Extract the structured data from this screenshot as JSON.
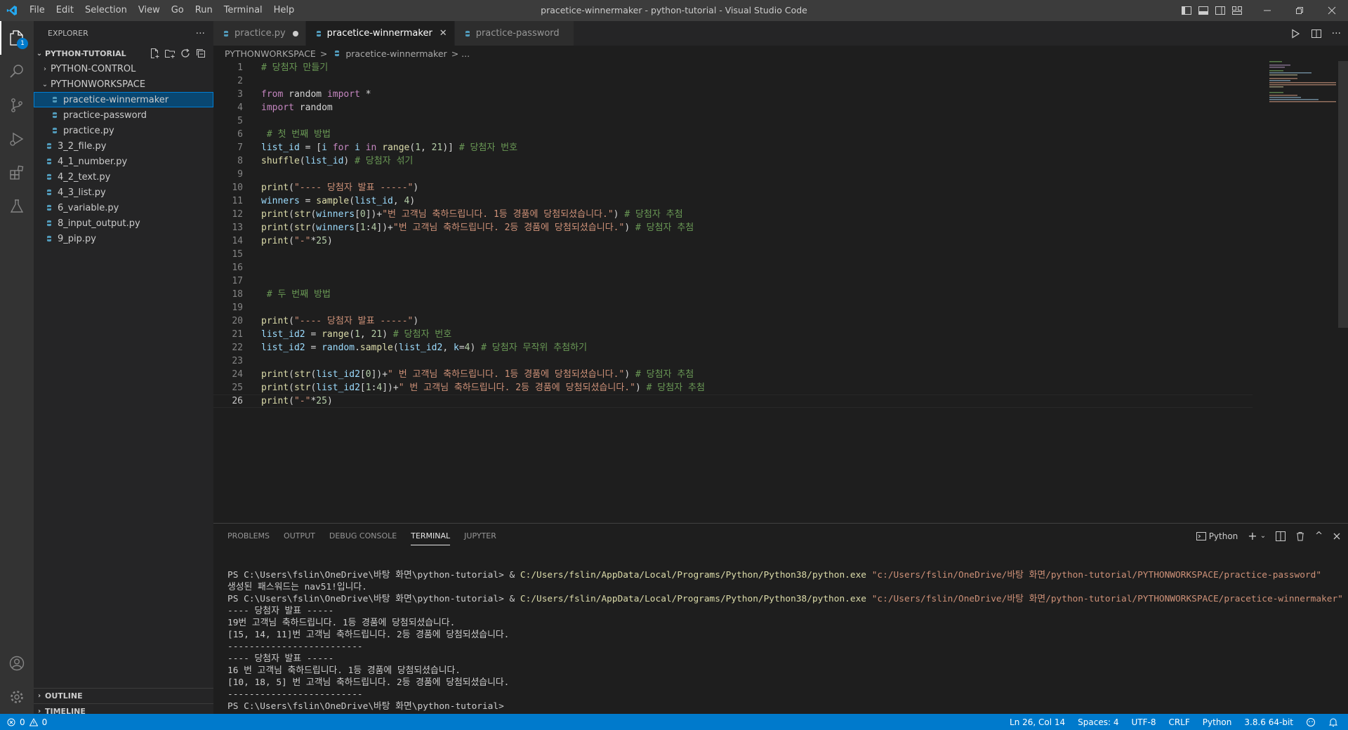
{
  "window": {
    "title": "pracetice-winnermaker - python-tutorial - Visual Studio Code",
    "menu": [
      "File",
      "Edit",
      "Selection",
      "View",
      "Go",
      "Run",
      "Terminal",
      "Help"
    ]
  },
  "activity": {
    "explorer_badge": "1"
  },
  "sidebar": {
    "title": "EXPLORER",
    "more": "···",
    "root": "PYTHON-TUTORIAL",
    "items": [
      {
        "label": "PYTHON-CONTROL",
        "kind": "folder",
        "expanded": false,
        "indent": 1
      },
      {
        "label": "PYTHONWORKSPACE",
        "kind": "folder",
        "expanded": true,
        "indent": 1
      },
      {
        "label": "pracetice-winnermaker",
        "kind": "file",
        "indent": 2,
        "selected": true
      },
      {
        "label": "practice-password",
        "kind": "file",
        "indent": 2
      },
      {
        "label": "practice.py",
        "kind": "file",
        "indent": 2
      },
      {
        "label": "3_2_file.py",
        "kind": "file",
        "indent": 1
      },
      {
        "label": "4_1_number.py",
        "kind": "file",
        "indent": 1
      },
      {
        "label": "4_2_text.py",
        "kind": "file",
        "indent": 1
      },
      {
        "label": "4_3_list.py",
        "kind": "file",
        "indent": 1
      },
      {
        "label": "6_variable.py",
        "kind": "file",
        "indent": 1
      },
      {
        "label": "8_input_output.py",
        "kind": "file",
        "indent": 1
      },
      {
        "label": "9_pip.py",
        "kind": "file",
        "indent": 1
      }
    ],
    "outline": "OUTLINE",
    "timeline": "TIMELINE"
  },
  "tabs": [
    {
      "label": "practice.py",
      "modified": true,
      "active": false
    },
    {
      "label": "pracetice-winnermaker",
      "modified": false,
      "active": true,
      "close": "✕"
    },
    {
      "label": "practice-password",
      "modified": false,
      "active": false
    }
  ],
  "breadcrumb": {
    "folder": "PYTHONWORKSPACE",
    "sep": ">",
    "file": "pracetice-winnermaker",
    "more": "> ..."
  },
  "code": {
    "current_line": 26,
    "lines": [
      [
        {
          "t": "# 당첨자 만들기",
          "c": "cm"
        }
      ],
      [],
      [
        {
          "t": "from",
          "c": "kw"
        },
        {
          "t": " random ",
          "c": "pl"
        },
        {
          "t": "import",
          "c": "kw"
        },
        {
          "t": " *",
          "c": "pl"
        }
      ],
      [
        {
          "t": "import",
          "c": "kw"
        },
        {
          "t": " random",
          "c": "pl"
        }
      ],
      [],
      [
        {
          "t": " # 첫 번째 방법",
          "c": "cm"
        }
      ],
      [
        {
          "t": "list_id",
          "c": "var"
        },
        {
          "t": " = [",
          "c": "pl"
        },
        {
          "t": "i",
          "c": "var"
        },
        {
          "t": " for ",
          "c": "kw"
        },
        {
          "t": "i",
          "c": "var"
        },
        {
          "t": " in ",
          "c": "kw"
        },
        {
          "t": "range",
          "c": "fn"
        },
        {
          "t": "(",
          "c": "pl"
        },
        {
          "t": "1",
          "c": "num"
        },
        {
          "t": ", ",
          "c": "pl"
        },
        {
          "t": "21",
          "c": "num"
        },
        {
          "t": ")] ",
          "c": "pl"
        },
        {
          "t": "# 당첨자 번호",
          "c": "cm"
        }
      ],
      [
        {
          "t": "shuffle",
          "c": "fn"
        },
        {
          "t": "(",
          "c": "pl"
        },
        {
          "t": "list_id",
          "c": "var"
        },
        {
          "t": ") ",
          "c": "pl"
        },
        {
          "t": "# 당첨자 섞기",
          "c": "cm"
        }
      ],
      [],
      [
        {
          "t": "print",
          "c": "fn"
        },
        {
          "t": "(",
          "c": "pl"
        },
        {
          "t": "\"---- 당첨자 발표 -----\"",
          "c": "str"
        },
        {
          "t": ")",
          "c": "pl"
        }
      ],
      [
        {
          "t": "winners",
          "c": "var"
        },
        {
          "t": " = ",
          "c": "pl"
        },
        {
          "t": "sample",
          "c": "fn"
        },
        {
          "t": "(",
          "c": "pl"
        },
        {
          "t": "list_id",
          "c": "var"
        },
        {
          "t": ", ",
          "c": "pl"
        },
        {
          "t": "4",
          "c": "num"
        },
        {
          "t": ")",
          "c": "pl"
        }
      ],
      [
        {
          "t": "print",
          "c": "fn"
        },
        {
          "t": "(",
          "c": "pl"
        },
        {
          "t": "str",
          "c": "fn"
        },
        {
          "t": "(",
          "c": "pl"
        },
        {
          "t": "winners",
          "c": "var"
        },
        {
          "t": "[",
          "c": "pl"
        },
        {
          "t": "0",
          "c": "num"
        },
        {
          "t": "])+",
          "c": "pl"
        },
        {
          "t": "\"번 고객님 축하드립니다. 1등 경품에 당첨되셨습니다.\"",
          "c": "str"
        },
        {
          "t": ") ",
          "c": "pl"
        },
        {
          "t": "# 당첨자 추첨",
          "c": "cm"
        }
      ],
      [
        {
          "t": "print",
          "c": "fn"
        },
        {
          "t": "(",
          "c": "pl"
        },
        {
          "t": "str",
          "c": "fn"
        },
        {
          "t": "(",
          "c": "pl"
        },
        {
          "t": "winners",
          "c": "var"
        },
        {
          "t": "[",
          "c": "pl"
        },
        {
          "t": "1",
          "c": "num"
        },
        {
          "t": ":",
          "c": "pl"
        },
        {
          "t": "4",
          "c": "num"
        },
        {
          "t": "])+",
          "c": "pl"
        },
        {
          "t": "\"번 고객님 축하드립니다. 2등 경품에 당첨되셨습니다.\"",
          "c": "str"
        },
        {
          "t": ") ",
          "c": "pl"
        },
        {
          "t": "# 당첨자 추첨",
          "c": "cm"
        }
      ],
      [
        {
          "t": "print",
          "c": "fn"
        },
        {
          "t": "(",
          "c": "pl"
        },
        {
          "t": "\"-\"",
          "c": "str"
        },
        {
          "t": "*",
          "c": "pl"
        },
        {
          "t": "25",
          "c": "num"
        },
        {
          "t": ")",
          "c": "pl"
        }
      ],
      [],
      [],
      [],
      [
        {
          "t": " # 두 번째 방법",
          "c": "cm"
        }
      ],
      [],
      [
        {
          "t": "print",
          "c": "fn"
        },
        {
          "t": "(",
          "c": "pl"
        },
        {
          "t": "\"---- 당첨자 발표 -----\"",
          "c": "str"
        },
        {
          "t": ")",
          "c": "pl"
        }
      ],
      [
        {
          "t": "list_id2",
          "c": "var"
        },
        {
          "t": " = ",
          "c": "pl"
        },
        {
          "t": "range",
          "c": "fn"
        },
        {
          "t": "(",
          "c": "pl"
        },
        {
          "t": "1",
          "c": "num"
        },
        {
          "t": ", ",
          "c": "pl"
        },
        {
          "t": "21",
          "c": "num"
        },
        {
          "t": ") ",
          "c": "pl"
        },
        {
          "t": "# 당첨자 번호",
          "c": "cm"
        }
      ],
      [
        {
          "t": "list_id2",
          "c": "var"
        },
        {
          "t": " = ",
          "c": "pl"
        },
        {
          "t": "random",
          "c": "var"
        },
        {
          "t": ".",
          "c": "pl"
        },
        {
          "t": "sample",
          "c": "fn"
        },
        {
          "t": "(",
          "c": "pl"
        },
        {
          "t": "list_id2",
          "c": "var"
        },
        {
          "t": ", ",
          "c": "pl"
        },
        {
          "t": "k",
          "c": "var"
        },
        {
          "t": "=",
          "c": "pl"
        },
        {
          "t": "4",
          "c": "num"
        },
        {
          "t": ") ",
          "c": "pl"
        },
        {
          "t": "# 당첨자 무작위 추첨하기",
          "c": "cm"
        }
      ],
      [],
      [
        {
          "t": "print",
          "c": "fn"
        },
        {
          "t": "(",
          "c": "pl"
        },
        {
          "t": "str",
          "c": "fn"
        },
        {
          "t": "(",
          "c": "pl"
        },
        {
          "t": "list_id2",
          "c": "var"
        },
        {
          "t": "[",
          "c": "pl"
        },
        {
          "t": "0",
          "c": "num"
        },
        {
          "t": "])+",
          "c": "pl"
        },
        {
          "t": "\" 번 고객님 축하드립니다. 1등 경품에 당첨되셨습니다.\"",
          "c": "str"
        },
        {
          "t": ") ",
          "c": "pl"
        },
        {
          "t": "# 당첨자 추첨",
          "c": "cm"
        }
      ],
      [
        {
          "t": "print",
          "c": "fn"
        },
        {
          "t": "(",
          "c": "pl"
        },
        {
          "t": "str",
          "c": "fn"
        },
        {
          "t": "(",
          "c": "pl"
        },
        {
          "t": "list_id2",
          "c": "var"
        },
        {
          "t": "[",
          "c": "pl"
        },
        {
          "t": "1",
          "c": "num"
        },
        {
          "t": ":",
          "c": "pl"
        },
        {
          "t": "4",
          "c": "num"
        },
        {
          "t": "])+",
          "c": "pl"
        },
        {
          "t": "\" 번 고객님 축하드립니다. 2등 경품에 당첨되셨습니다.\"",
          "c": "str"
        },
        {
          "t": ") ",
          "c": "pl"
        },
        {
          "t": "# 당첨자 추첨",
          "c": "cm"
        }
      ],
      [
        {
          "t": "print",
          "c": "fn"
        },
        {
          "t": "(",
          "c": "pl"
        },
        {
          "t": "\"-\"",
          "c": "str"
        },
        {
          "t": "*",
          "c": "pl"
        },
        {
          "t": "25",
          "c": "num"
        },
        {
          "t": ")",
          "c": "pl"
        }
      ]
    ]
  },
  "syntax_colors": {
    "cm": "#6a9955",
    "kw": "#c586c0",
    "pl": "#d4d4d4",
    "var": "#9cdcfe",
    "fn": "#dcdcaa",
    "num": "#b5cea8",
    "str": "#ce9178"
  },
  "panel": {
    "tabs": [
      "PROBLEMS",
      "OUTPUT",
      "DEBUG CONSOLE",
      "TERMINAL",
      "JUPYTER"
    ],
    "active_tab": "TERMINAL",
    "shell": "Python",
    "terminal_lines": [
      [
        {
          "t": "PS C:\\Users\\fslin\\OneDrive\\바탕 화면\\python-tutorial> & ",
          "c": "pl"
        },
        {
          "t": "C:/Users/fslin/AppData/Local/Programs/Python/Python38/python.exe",
          "c": "yel"
        },
        {
          "t": " ",
          "c": "pl"
        },
        {
          "t": "\"c:/Users/fslin/OneDrive/바탕 화면/python-tutorial/PYTHONWORKSPACE/practice-password\"",
          "c": "blu"
        }
      ],
      [
        {
          "t": "생성된 패스워드는 nav51!입니다.",
          "c": "pl"
        }
      ],
      [
        {
          "t": "PS C:\\Users\\fslin\\OneDrive\\바탕 화면\\python-tutorial> & ",
          "c": "pl"
        },
        {
          "t": "C:/Users/fslin/AppData/Local/Programs/Python/Python38/python.exe",
          "c": "yel"
        },
        {
          "t": " ",
          "c": "pl"
        },
        {
          "t": "\"c:/Users/fslin/OneDrive/바탕 화면/python-tutorial/PYTHONWORKSPACE/pracetice-winnermaker\"",
          "c": "blu"
        }
      ],
      [
        {
          "t": "---- 당첨자 발표 -----",
          "c": "pl"
        }
      ],
      [
        {
          "t": "19번 고객님 축하드립니다. 1등 경품에 당첨되셨습니다.",
          "c": "pl"
        }
      ],
      [
        {
          "t": "[15, 14, 11]번 고객님 축하드립니다. 2등 경품에 당첨되셨습니다.",
          "c": "pl"
        }
      ],
      [
        {
          "t": "-------------------------",
          "c": "pl"
        }
      ],
      [
        {
          "t": "---- 당첨자 발표 -----",
          "c": "pl"
        }
      ],
      [
        {
          "t": "16 번 고객님 축하드립니다. 1등 경품에 당첨되셨습니다.",
          "c": "pl"
        }
      ],
      [
        {
          "t": "[10, 18, 5] 번 고객님 축하드립니다. 2등 경품에 당첨되셨습니다.",
          "c": "pl"
        }
      ],
      [
        {
          "t": "-------------------------",
          "c": "pl"
        }
      ],
      [
        {
          "t": "PS C:\\Users\\fslin\\OneDrive\\바탕 화면\\python-tutorial> ",
          "c": "pl"
        }
      ]
    ]
  },
  "statusbar": {
    "errors": "0",
    "warnings": "0",
    "position": "Ln 26, Col 14",
    "spaces": "Spaces: 4",
    "encoding": "UTF-8",
    "eol": "CRLF",
    "language": "Python",
    "interpreter": "3.8.6 64-bit"
  }
}
